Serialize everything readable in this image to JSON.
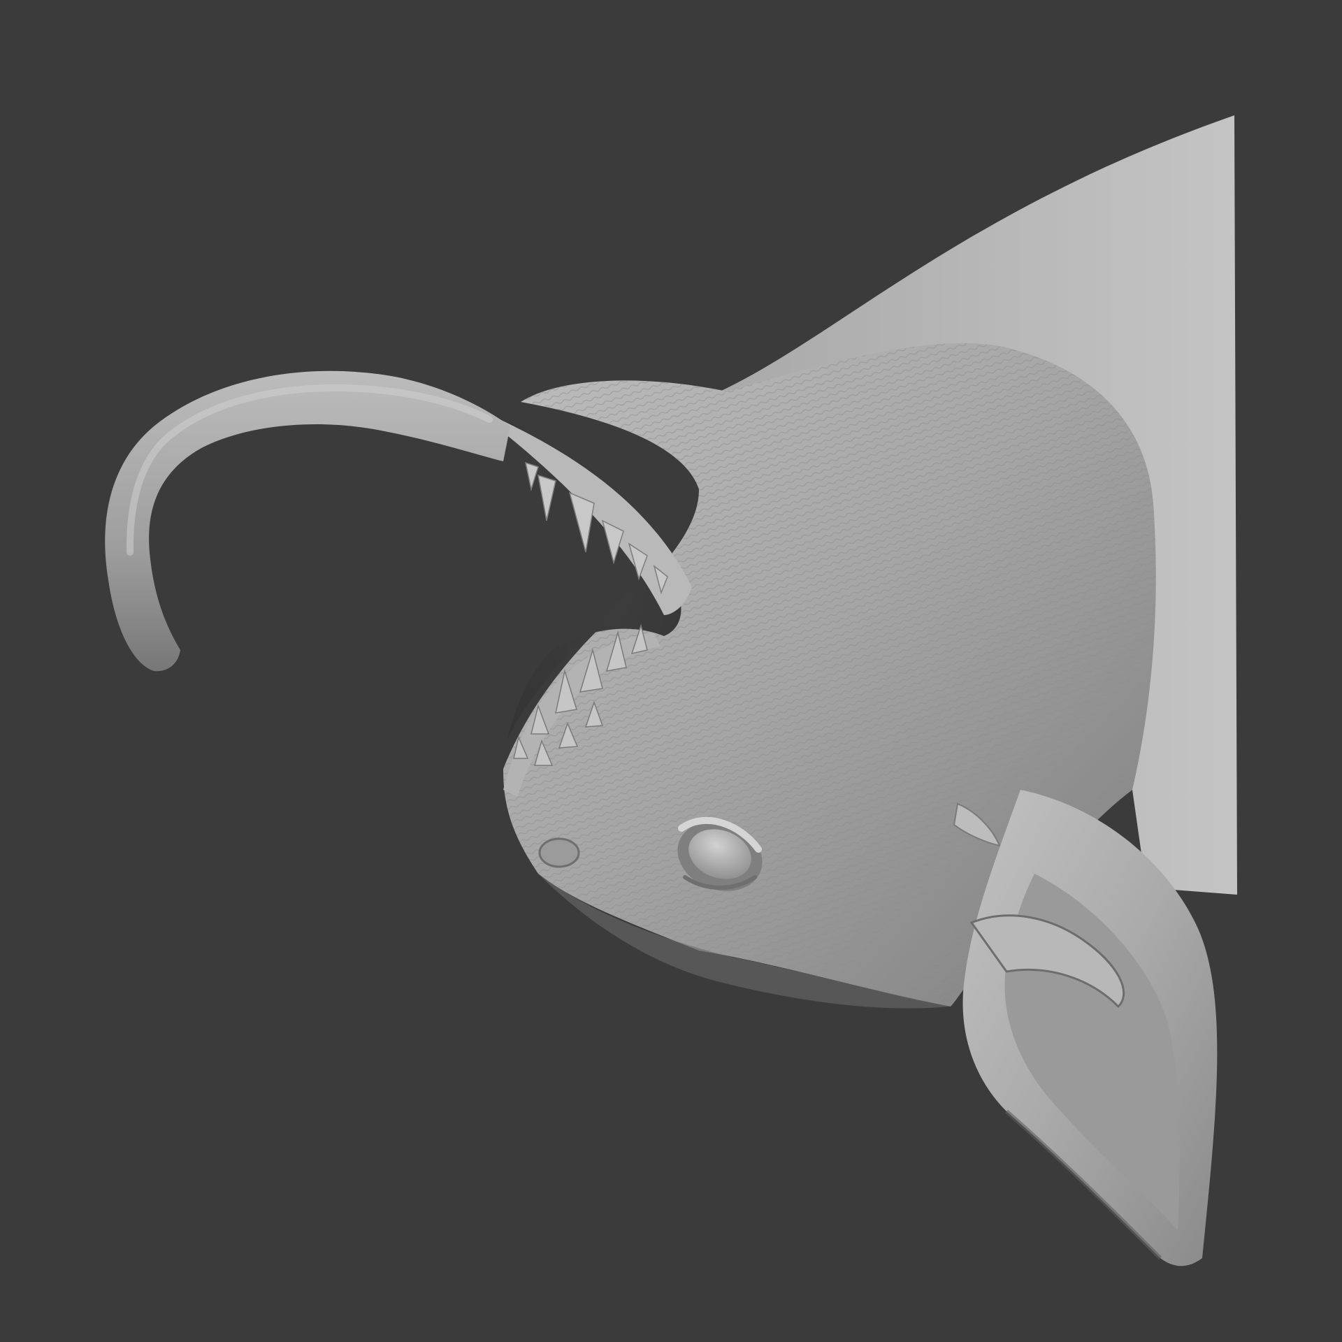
{
  "viewport": {
    "background": "#3b3b3b",
    "subject": "sculpt-creature-head",
    "material": {
      "base": "#a3a3a3",
      "light": "#c9c9c9",
      "mid": "#9a9a9a",
      "shadow": "#6e6e6e",
      "deep": "#4f4f4f"
    }
  }
}
